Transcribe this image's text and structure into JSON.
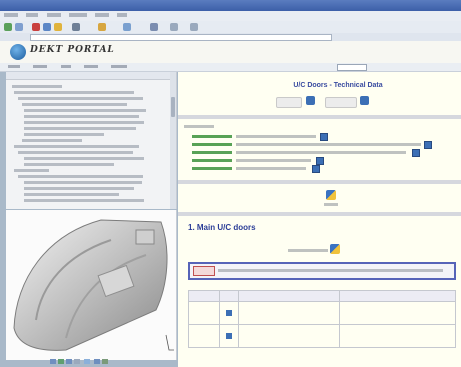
{
  "header": {
    "logo_text": "DEKT PORTAL",
    "page_title": "U/C Doors - Technical Data"
  },
  "colors": {
    "titlebar": "#3c5fa8",
    "title_blue": "#2b3d97",
    "link_green": "#2e8b2e",
    "content_bg": "#fffff2",
    "accent_border": "#5663b8"
  },
  "icons": {
    "globe": "globe-logo-icon",
    "doc": "document-icon",
    "view": "view-icon"
  },
  "main": {
    "section_title": "1. Main U/C doors"
  }
}
